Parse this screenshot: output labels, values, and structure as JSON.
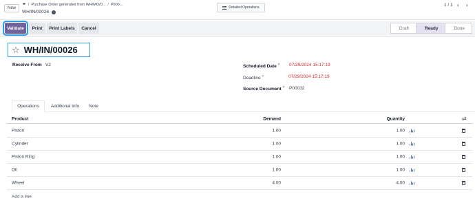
{
  "topbar": {
    "new_label": "New",
    "breadcrumbs": [
      "Purchase Order generated from WH/MO/0...",
      "P000..."
    ],
    "record_name": "WH/IN/00026",
    "detailed_ops_label": "Detailed Operations",
    "pager": "1 / 1"
  },
  "actions": {
    "validate": "Validate",
    "print": "Print",
    "print_labels": "Print Labels",
    "cancel": "Cancel"
  },
  "status_bar": {
    "steps": [
      "Draft",
      "Ready",
      "Done"
    ],
    "active": "Ready"
  },
  "form": {
    "title": "WH/IN/00026",
    "receive_from_label": "Receive From",
    "receive_from_value": "V2",
    "scheduled_date_label": "Scheduled Date",
    "scheduled_date_value": "07/29/2024 15:17:19",
    "deadline_label": "Deadline",
    "deadline_value": "07/29/2024 15:17:19",
    "source_document_label": "Source Document",
    "source_document_value": "P00032",
    "help_mark": "?"
  },
  "tabs": [
    "Operations",
    "Additional Info",
    "Note"
  ],
  "table": {
    "headers": {
      "product": "Product",
      "demand": "Demand",
      "quantity": "Quantity"
    },
    "rows": [
      {
        "product": "Piston",
        "demand": "1.00",
        "quantity": "1.00"
      },
      {
        "product": "Cylinder",
        "demand": "1.00",
        "quantity": "1.00"
      },
      {
        "product": "Piston Ring",
        "demand": "1.00",
        "quantity": "1.00"
      },
      {
        "product": "Oil",
        "demand": "1.00",
        "quantity": "1.00"
      },
      {
        "product": "Wheel",
        "demand": "4.00",
        "quantity": "4.00"
      }
    ],
    "add_line": "Add a line"
  },
  "colors": {
    "primary": "#71639e",
    "focus_outline": "#2d9fe5",
    "date_red": "#dc2626"
  }
}
